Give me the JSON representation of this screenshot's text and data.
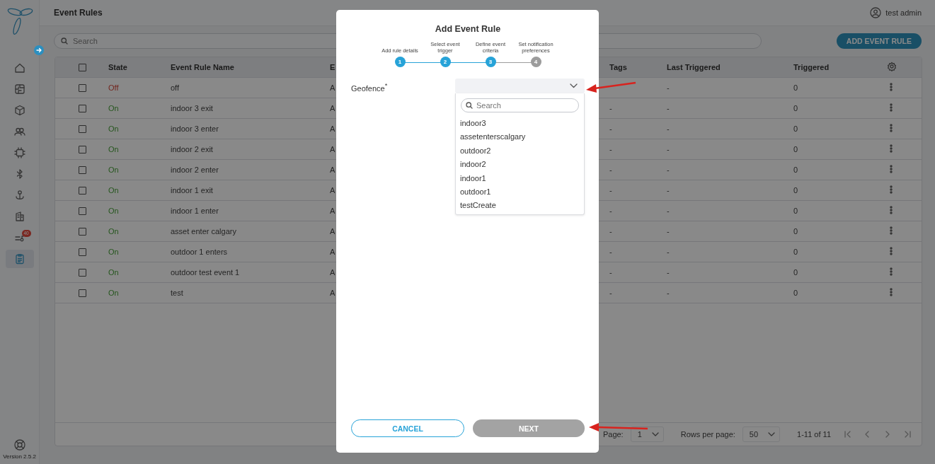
{
  "header": {
    "title": "Event Rules",
    "user": "test admin"
  },
  "sidebar": {
    "items": [
      {
        "selected": false
      },
      {
        "selected": false
      },
      {
        "selected": false
      },
      {
        "selected": false
      },
      {
        "selected": false
      },
      {
        "selected": false
      },
      {
        "selected": false
      },
      {
        "selected": false
      },
      {
        "selected": false,
        "badge": "40"
      },
      {
        "selected": true
      }
    ],
    "version": "Version 2.5.2"
  },
  "search": {
    "placeholder": "Search"
  },
  "add_button": "ADD EVENT RULE",
  "table": {
    "select_all_checked": false,
    "columns": [
      "State",
      "Event Rule Name",
      "E",
      "Tags",
      "Last Triggered",
      "Triggered"
    ],
    "rows": [
      {
        "checked": false,
        "state": "Off",
        "on": false,
        "name": "off",
        "column_4": "A",
        "last_triggered": "-",
        "triggered": "0"
      },
      {
        "checked": false,
        "state": "On",
        "on": true,
        "name": "indoor 3 exit",
        "column_4": "A",
        "tags": "-",
        "last_triggered": "-",
        "triggered": "0"
      },
      {
        "checked": false,
        "state": "On",
        "on": true,
        "name": "indoor 3 enter",
        "column_4": "A",
        "tags": "-",
        "last_triggered": "-",
        "triggered": "0"
      },
      {
        "checked": false,
        "state": "On",
        "on": true,
        "name": "indoor 2 exit",
        "column_4": "A",
        "tags": "-",
        "last_triggered": "-",
        "triggered": "0"
      },
      {
        "checked": false,
        "state": "On",
        "on": true,
        "name": "indoor 2 enter",
        "column_4": "A",
        "tags": "-",
        "last_triggered": "-",
        "triggered": "0"
      },
      {
        "checked": false,
        "state": "On",
        "on": true,
        "name": "indoor 1 exit",
        "column_4": "A",
        "tags": "-",
        "last_triggered": "-",
        "triggered": "0"
      },
      {
        "checked": false,
        "state": "On",
        "on": true,
        "name": "indoor 1 enter",
        "column_4": "A",
        "tags": "-",
        "last_triggered": "-",
        "triggered": "0"
      },
      {
        "checked": false,
        "state": "On",
        "on": true,
        "name": "asset enter calgary",
        "column_4": "A",
        "tags": "-",
        "last_triggered": "-",
        "triggered": "0"
      },
      {
        "checked": false,
        "state": "On",
        "on": true,
        "name": "outdoor 1 enters",
        "column_4": "A",
        "tags": "-",
        "last_triggered": "-",
        "triggered": "0"
      },
      {
        "checked": false,
        "state": "On",
        "on": true,
        "name": "outdoor test event 1",
        "column_4": "A",
        "tags": "-",
        "last_triggered": "-",
        "triggered": "0"
      },
      {
        "checked": false,
        "state": "On",
        "on": true,
        "name": "test",
        "column_4": "A",
        "tags": "-",
        "last_triggered": "-",
        "triggered": "0"
      }
    ]
  },
  "pagination": {
    "page_label": "Page:",
    "page": "1",
    "rows_label": "Rows per page:",
    "rows": "50",
    "range": "1-11 of 11"
  },
  "modal": {
    "title": "Add Event Rule",
    "steps": [
      {
        "label": "Add rule details",
        "number": "1",
        "active": true
      },
      {
        "label": "Select event trigger",
        "number": "2",
        "active": true
      },
      {
        "label": "Define event criteria",
        "number": "3",
        "active": true
      },
      {
        "label": "Set notification preferences",
        "number": "4",
        "active": false
      }
    ],
    "field": {
      "label": "Geofence$^{*}$",
      "expanded": true
    },
    "dropdown": {
      "search_placeholder": "Search",
      "options": [
        "indoor3",
        "assetenterscalgary",
        "outdoor2",
        "indoor2",
        "indoor1",
        "outdoor1",
        "testCreate"
      ]
    },
    "buttons": [
      {
        "label": "CANCEL",
        "kind": "outline",
        "disabled": false
      },
      {
        "label": "NEXT",
        "kind": "primary",
        "disabled": true
      }
    ]
  }
}
